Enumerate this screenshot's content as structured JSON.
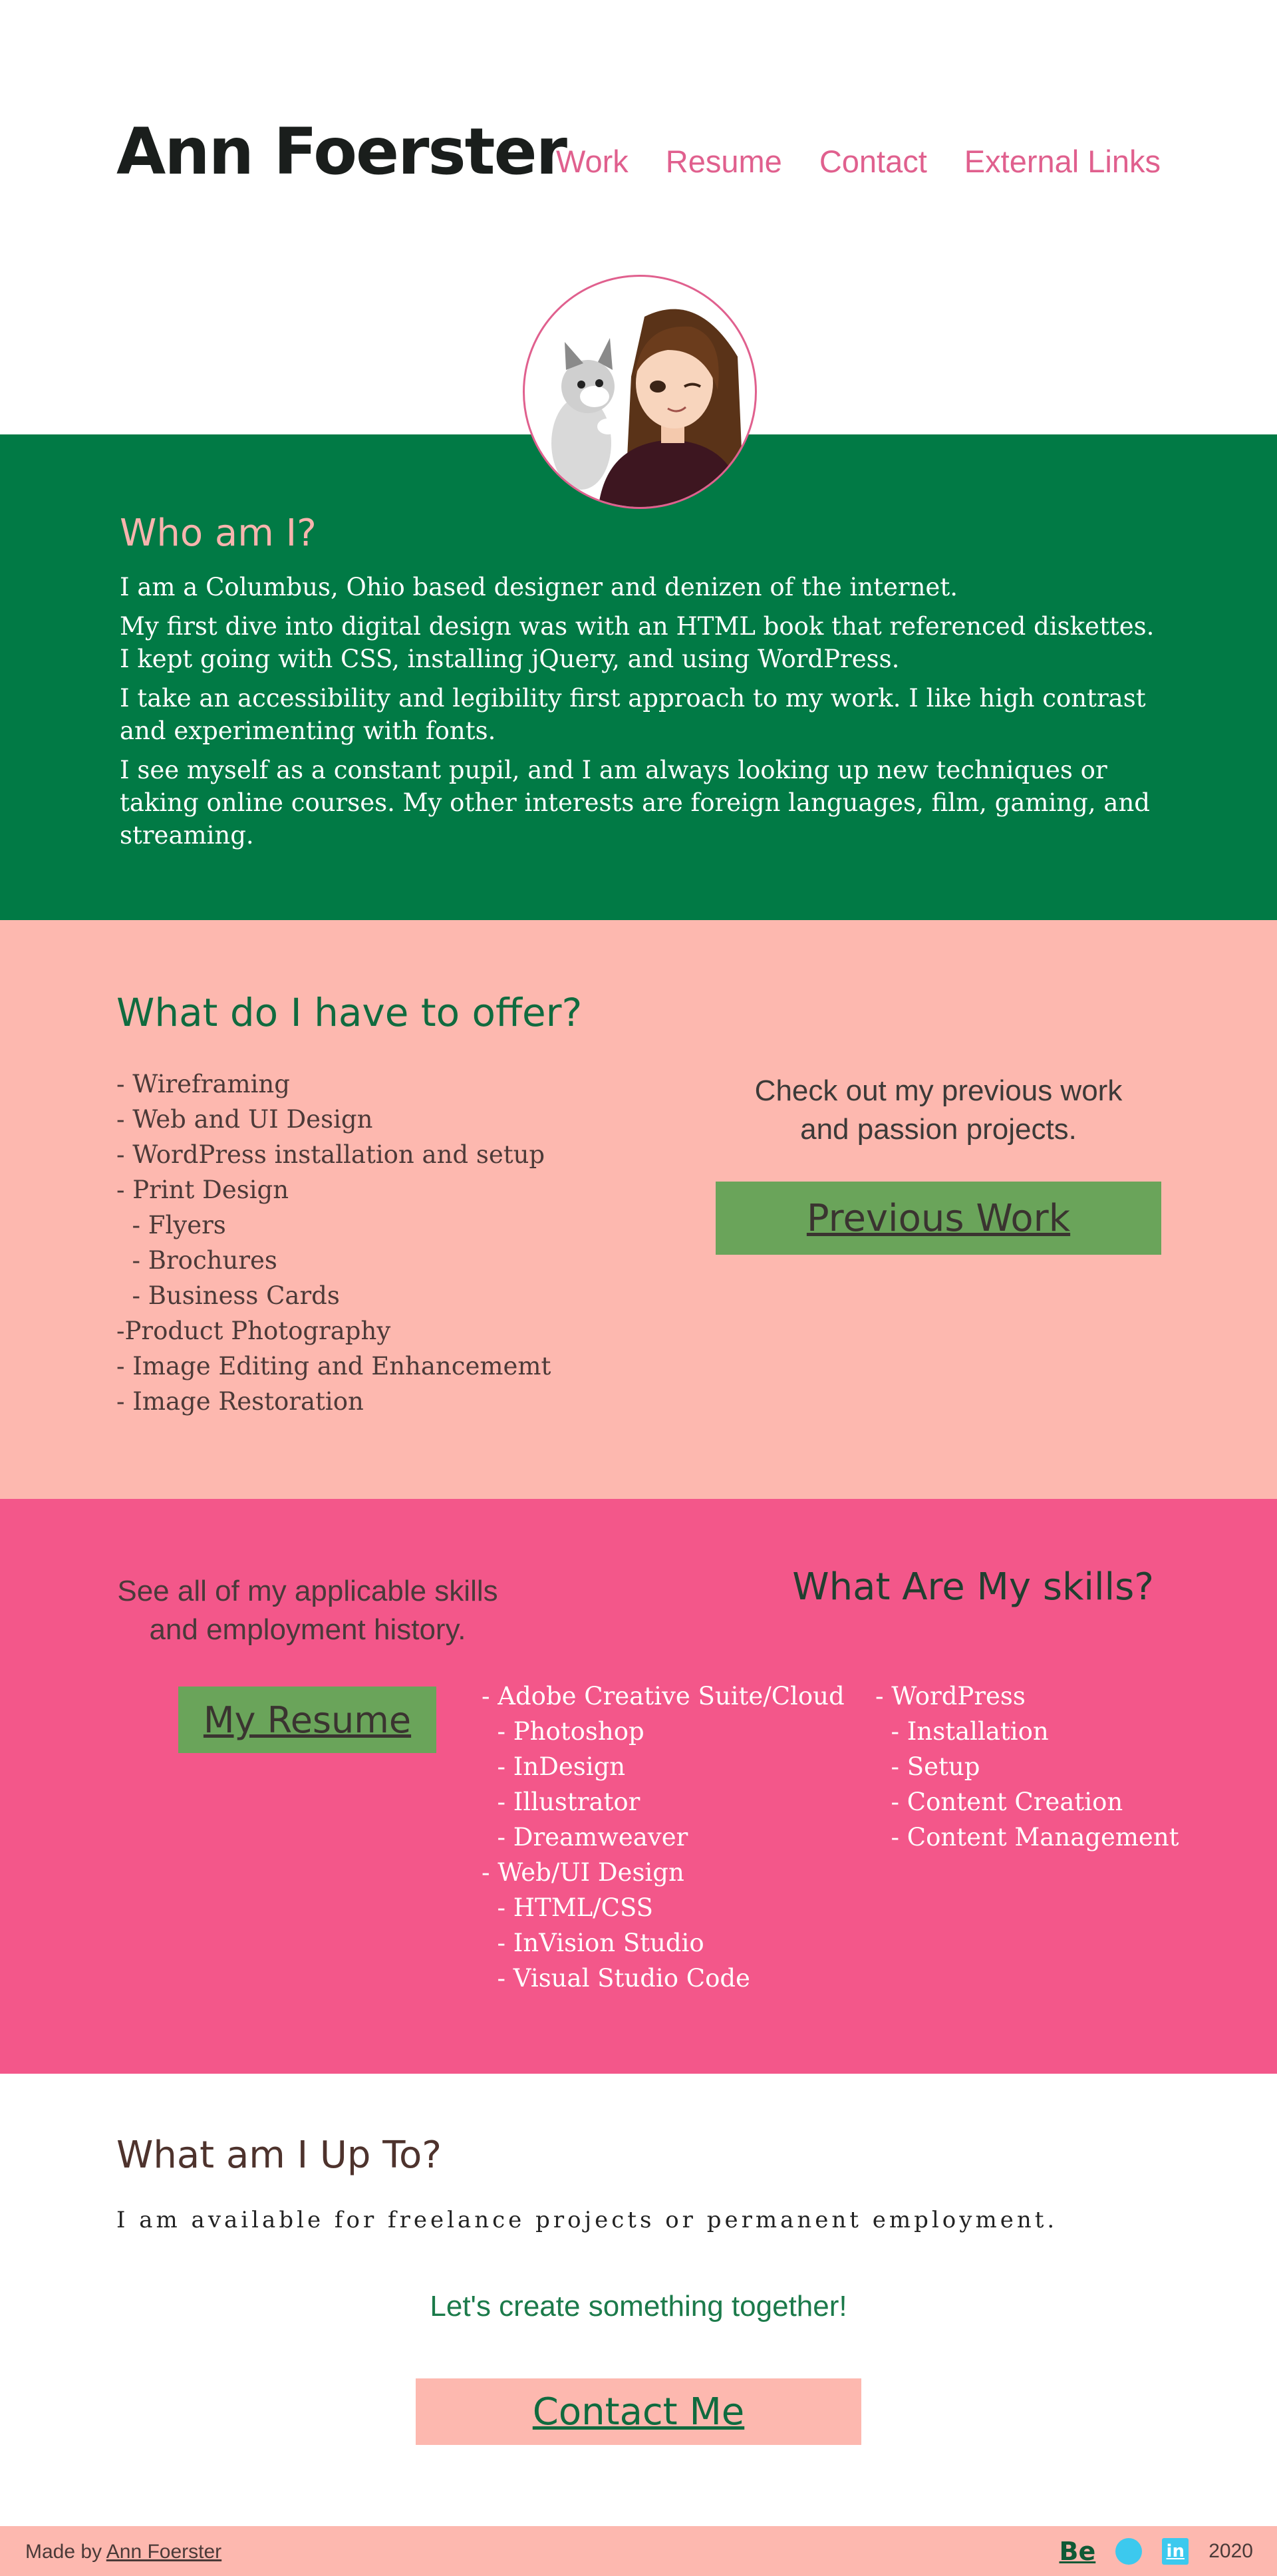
{
  "header": {
    "title": "Ann Foerster",
    "nav": [
      "Work",
      "Resume",
      "Contact",
      "External Links"
    ]
  },
  "about": {
    "heading": "Who am I?",
    "paragraphs": [
      "I am a Columbus, Ohio based designer and denizen of the internet.",
      "My first dive into digital design was with an HTML book that referenced diskettes.  I kept going with CSS, installing jQuery, and using WordPress.",
      "I take an accessibility and legibility first approach to my work.  I like high contrast and experimenting with fonts.",
      "I see myself as a constant pupil, and I am always looking up new techniques or taking online courses.  My other interests are foreign languages, film, gaming, and streaming."
    ]
  },
  "offer": {
    "heading": "What do I have to offer?",
    "items": [
      "- Wireframing",
      "- Web and UI Design",
      "- WordPress installation and setup",
      "- Print Design",
      "  - Flyers",
      "  - Brochures",
      "  - Business Cards",
      "-Product Photography",
      "- Image Editing and Enhancememt",
      "- Image Restoration"
    ],
    "cta_line1": "Check out my previous work",
    "cta_line2": "and passion projects.",
    "button": "Previous Work"
  },
  "skills": {
    "cta_line1": "See all of my applicable skills",
    "cta_line2": "and employment history.",
    "button": "My Resume",
    "heading": "What Are My skills?",
    "col1": [
      "- Adobe Creative Suite/Cloud",
      "  - Photoshop",
      "  - InDesign",
      "  - Illustrator",
      "  - Dreamweaver",
      "- Web/UI Design",
      "  - HTML/CSS",
      "  - InVision Studio",
      "  - Visual Studio Code"
    ],
    "col2": [
      "- WordPress",
      "  - Installation",
      "  - Setup",
      "  - Content Creation",
      "  - Content Management"
    ]
  },
  "upto": {
    "heading": "What am I Up To?",
    "text": "I am available for freelance projects or permanent employment.",
    "cta": "Let's create something together!",
    "button": "Contact Me"
  },
  "footer": {
    "made_by": "Made by",
    "author": "Ann Foerster",
    "behance": "Be",
    "linkedin": "in",
    "year": "2020",
    "icons": [
      "behance-icon",
      "dribbble-icon",
      "linkedin-icon"
    ]
  },
  "colors": {
    "green": "#017a45",
    "pink": "#f3578a",
    "peach": "#fdb8af",
    "button_green": "#6aa45a",
    "nav_pink": "#e0608e"
  }
}
